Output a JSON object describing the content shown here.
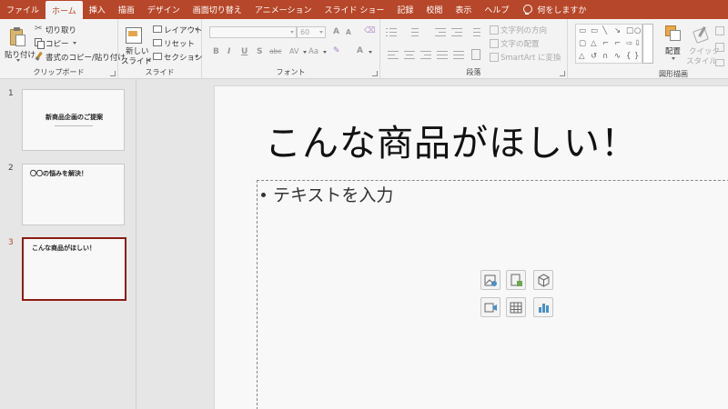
{
  "menubar": {
    "tabs": [
      "ファイル",
      "ホーム",
      "挿入",
      "描画",
      "デザイン",
      "画面切り替え",
      "アニメーション",
      "スライド ショー",
      "記録",
      "校閲",
      "表示",
      "ヘルプ"
    ],
    "active_tab": "ホーム",
    "tell_me": "何をしますか"
  },
  "ribbon": {
    "clipboard": {
      "label": "クリップボード",
      "paste": "貼り付け",
      "cut": "切り取り",
      "copy": "コピー",
      "format_painter": "書式のコピー/貼り付け"
    },
    "slides": {
      "label": "スライド",
      "new_slide_line1": "新しい",
      "new_slide_line2": "スライド",
      "layout": "レイアウト",
      "reset": "リセット",
      "section": "セクション"
    },
    "font": {
      "label": "フォント",
      "font_size": "60",
      "grow": "A",
      "shrink": "A",
      "bold": "B",
      "italic": "I",
      "underline": "U",
      "shadow": "S",
      "strike": "abc",
      "spacing": "AV",
      "case": "Aa",
      "color": "A"
    },
    "paragraph": {
      "label": "段落",
      "text_direction": "文字列の方向",
      "align_text": "文字の配置",
      "smartart": "SmartArt に変換"
    },
    "drawing": {
      "label": "図形描画",
      "arrange": "配置",
      "quick_styles_line1": "クイック",
      "quick_styles_line2": "スタイル"
    }
  },
  "thumbnails": [
    {
      "number": "1",
      "title": "新商品企画のご提案"
    },
    {
      "number": "2",
      "title": "〇〇の悩みを解決！"
    },
    {
      "number": "3",
      "title": "こんな商品がほしい！"
    }
  ],
  "slide": {
    "title": "こんな商品がほしい！",
    "bullet": "テキストを入力"
  },
  "colors": {
    "accent": "#b7472a",
    "selected_border": "#8c1c13"
  }
}
